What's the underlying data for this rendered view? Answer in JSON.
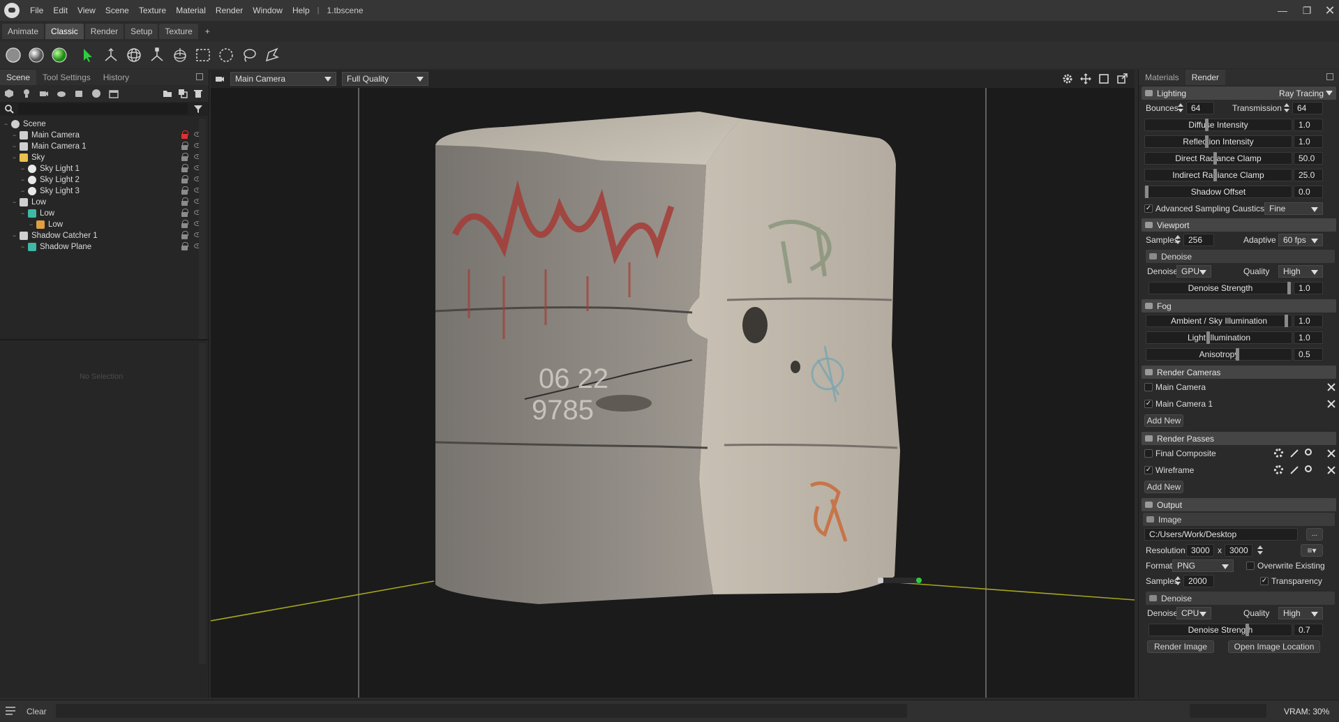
{
  "app": {
    "menu": [
      "File",
      "Edit",
      "View",
      "Scene",
      "Texture",
      "Material",
      "Render",
      "Window",
      "Help"
    ],
    "document_title": "1.tbscene",
    "window_controls": [
      "minimize-icon",
      "restore-icon",
      "close-icon"
    ]
  },
  "workspace_tabs": [
    "Animate",
    "Classic",
    "Render",
    "Setup",
    "Texture",
    "+"
  ],
  "active_workspace": "Classic",
  "left_panel": {
    "tabs": [
      "Scene",
      "Tool Settings",
      "History"
    ],
    "tree": [
      {
        "label": "Scene",
        "depth": 0,
        "icon": "scene-icon"
      },
      {
        "label": "Main Camera",
        "depth": 1,
        "icon": "camera-icon",
        "locked": true
      },
      {
        "label": "Main Camera 1",
        "depth": 1,
        "icon": "camera-icon"
      },
      {
        "label": "Sky",
        "depth": 1,
        "icon": "sky-icon"
      },
      {
        "label": "Sky Light 1",
        "depth": 2,
        "icon": "light-bulb-icon"
      },
      {
        "label": "Sky Light 2",
        "depth": 2,
        "icon": "light-bulb-icon"
      },
      {
        "label": "Sky Light 3",
        "depth": 2,
        "icon": "light-bulb-icon"
      },
      {
        "label": "Low",
        "depth": 1,
        "icon": "group-icon"
      },
      {
        "label": "Low",
        "depth": 2,
        "icon": "mesh-icon"
      },
      {
        "label": "Low",
        "depth": 3,
        "icon": "material-icon"
      },
      {
        "label": "Shadow Catcher 1",
        "depth": 1,
        "icon": "shadow-catcher-icon"
      },
      {
        "label": "Shadow Plane",
        "depth": 2,
        "icon": "mesh-icon"
      }
    ],
    "no_selection": "No Selection"
  },
  "viewport": {
    "camera": "Main Camera",
    "quality": "Full Quality"
  },
  "right_panel": {
    "tabs": [
      "Materials",
      "Render"
    ],
    "lighting": {
      "title": "Lighting",
      "mode": "Ray Tracing",
      "bounces_label": "Bounces",
      "bounces": "64",
      "transmission_label": "Transmission",
      "transmission": "64",
      "diffuse_label": "Diffuse Intensity",
      "diffuse": "1.0",
      "reflection_label": "Reflection Intensity",
      "reflection": "1.0",
      "direct_label": "Direct Radiance Clamp",
      "direct": "50.0",
      "indirect_label": "Indirect Radiance Clamp",
      "indirect": "25.0",
      "shadow_label": "Shadow Offset",
      "shadow": "0.0",
      "adv_label": "Advanced Sampling",
      "caustics_label": "Caustics",
      "caustics": "Fine"
    },
    "viewport": {
      "title": "Viewport",
      "samples_label": "Samples",
      "samples": "256",
      "adaptive_label": "Adaptive",
      "adaptive": "60 fps",
      "denoise_title": "Denoise",
      "denoise_label": "Denoise",
      "denoise": "GPU",
      "quality_label": "Quality",
      "quality": "High",
      "strength_label": "Denoise Strength",
      "strength": "1.0"
    },
    "fog": {
      "title": "Fog",
      "ambient_label": "Ambient / Sky Illumination",
      "ambient": "1.0",
      "light_label": "Light Illumination",
      "light": "1.0",
      "aniso_label": "Anisotropy",
      "aniso": "0.5"
    },
    "render_cameras": {
      "title": "Render Cameras",
      "items": [
        {
          "label": "Main Camera",
          "checked": false
        },
        {
          "label": "Main Camera 1",
          "checked": true
        }
      ],
      "add_new": "Add New"
    },
    "render_passes": {
      "title": "Render Passes",
      "items": [
        {
          "label": "Final Composite",
          "checked": false
        },
        {
          "label": "Wireframe",
          "checked": true
        }
      ],
      "add_new": "Add New"
    },
    "output": {
      "title": "Output",
      "image_title": "Image",
      "path": "C:/Users/Work/Desktop",
      "browse": "...",
      "resolution_label": "Resolution:",
      "res_w": "3000",
      "res_x": "x",
      "res_h": "3000",
      "format_label": "Format",
      "format": "PNG",
      "overwrite_label": "Overwrite Existing",
      "samples_label": "Samples",
      "samples": "2000",
      "transparency_label": "Transparency",
      "denoise_title": "Denoise",
      "denoise_label": "Denoise",
      "denoise": "CPU",
      "quality_label": "Quality",
      "quality": "High",
      "strength_label": "Denoise Strength",
      "strength": "0.7",
      "render_image": "Render Image",
      "open_location": "Open Image Location"
    }
  },
  "status": {
    "clear": "Clear",
    "vram": "VRAM: 30%"
  },
  "colors": {
    "accent_green": "#2ecc40",
    "lock_red": "#e03030",
    "ground_line": "#a6a61e"
  }
}
